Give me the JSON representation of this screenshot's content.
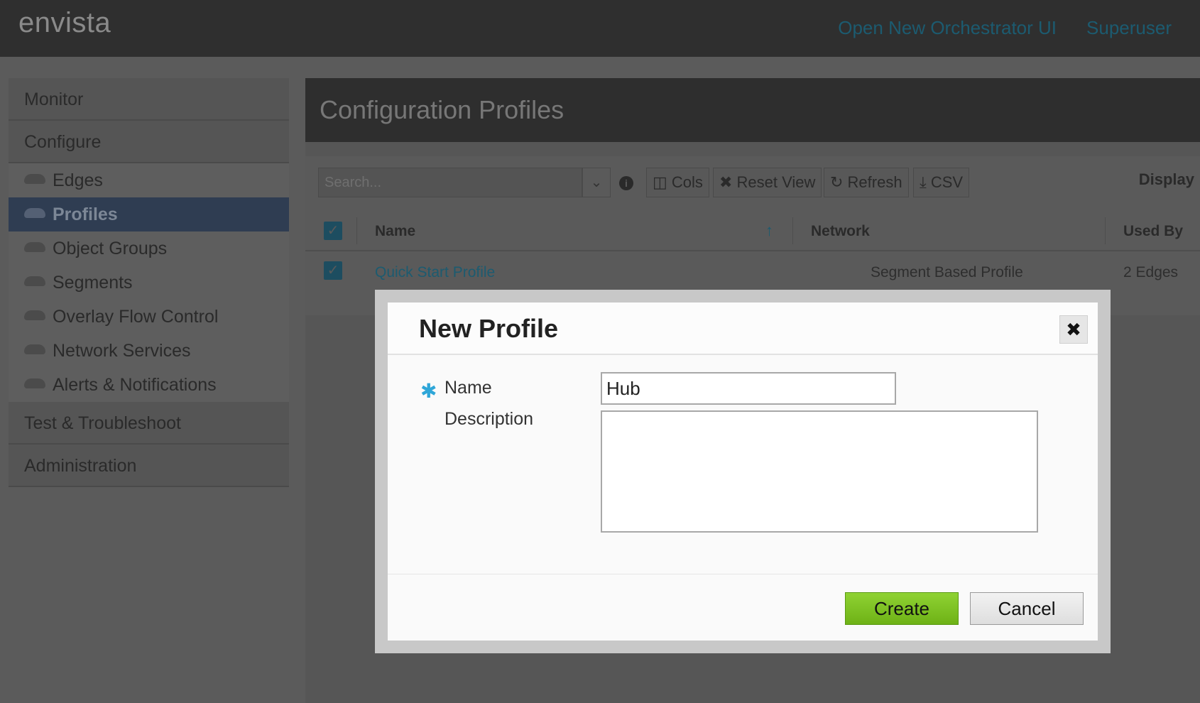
{
  "topbar": {
    "brand": "envista",
    "links": [
      "Open New Orchestrator UI",
      "Superuser"
    ]
  },
  "sidebar": {
    "monitor": "Monitor",
    "configure": "Configure",
    "items": [
      {
        "label": "Edges"
      },
      {
        "label": "Profiles",
        "active": true
      },
      {
        "label": "Object Groups"
      },
      {
        "label": "Segments"
      },
      {
        "label": "Overlay Flow Control"
      },
      {
        "label": "Network Services"
      },
      {
        "label": "Alerts & Notifications"
      }
    ],
    "test": "Test & Troubleshoot",
    "admin": "Administration"
  },
  "page": {
    "title": "Configuration Profiles",
    "search_placeholder": "Search...",
    "toolbar": {
      "cols": "Cols",
      "reset": "Reset View",
      "refresh": "Refresh",
      "csv": "CSV",
      "display": "Display"
    },
    "table": {
      "headers": [
        "Name",
        "Network",
        "Used By"
      ],
      "rows": [
        {
          "name": "Quick Start Profile",
          "network": "Segment Based Profile",
          "used_by": "2 Edges"
        }
      ]
    }
  },
  "modal": {
    "title": "New Profile",
    "name_label": "Name",
    "description_label": "Description",
    "name_value": "Hub",
    "description_value": "",
    "create": "Create",
    "cancel": "Cancel"
  },
  "colors": {
    "accent": "#2ea6d8",
    "create_button": "#7cc324",
    "active_nav": "#2f3d52"
  }
}
